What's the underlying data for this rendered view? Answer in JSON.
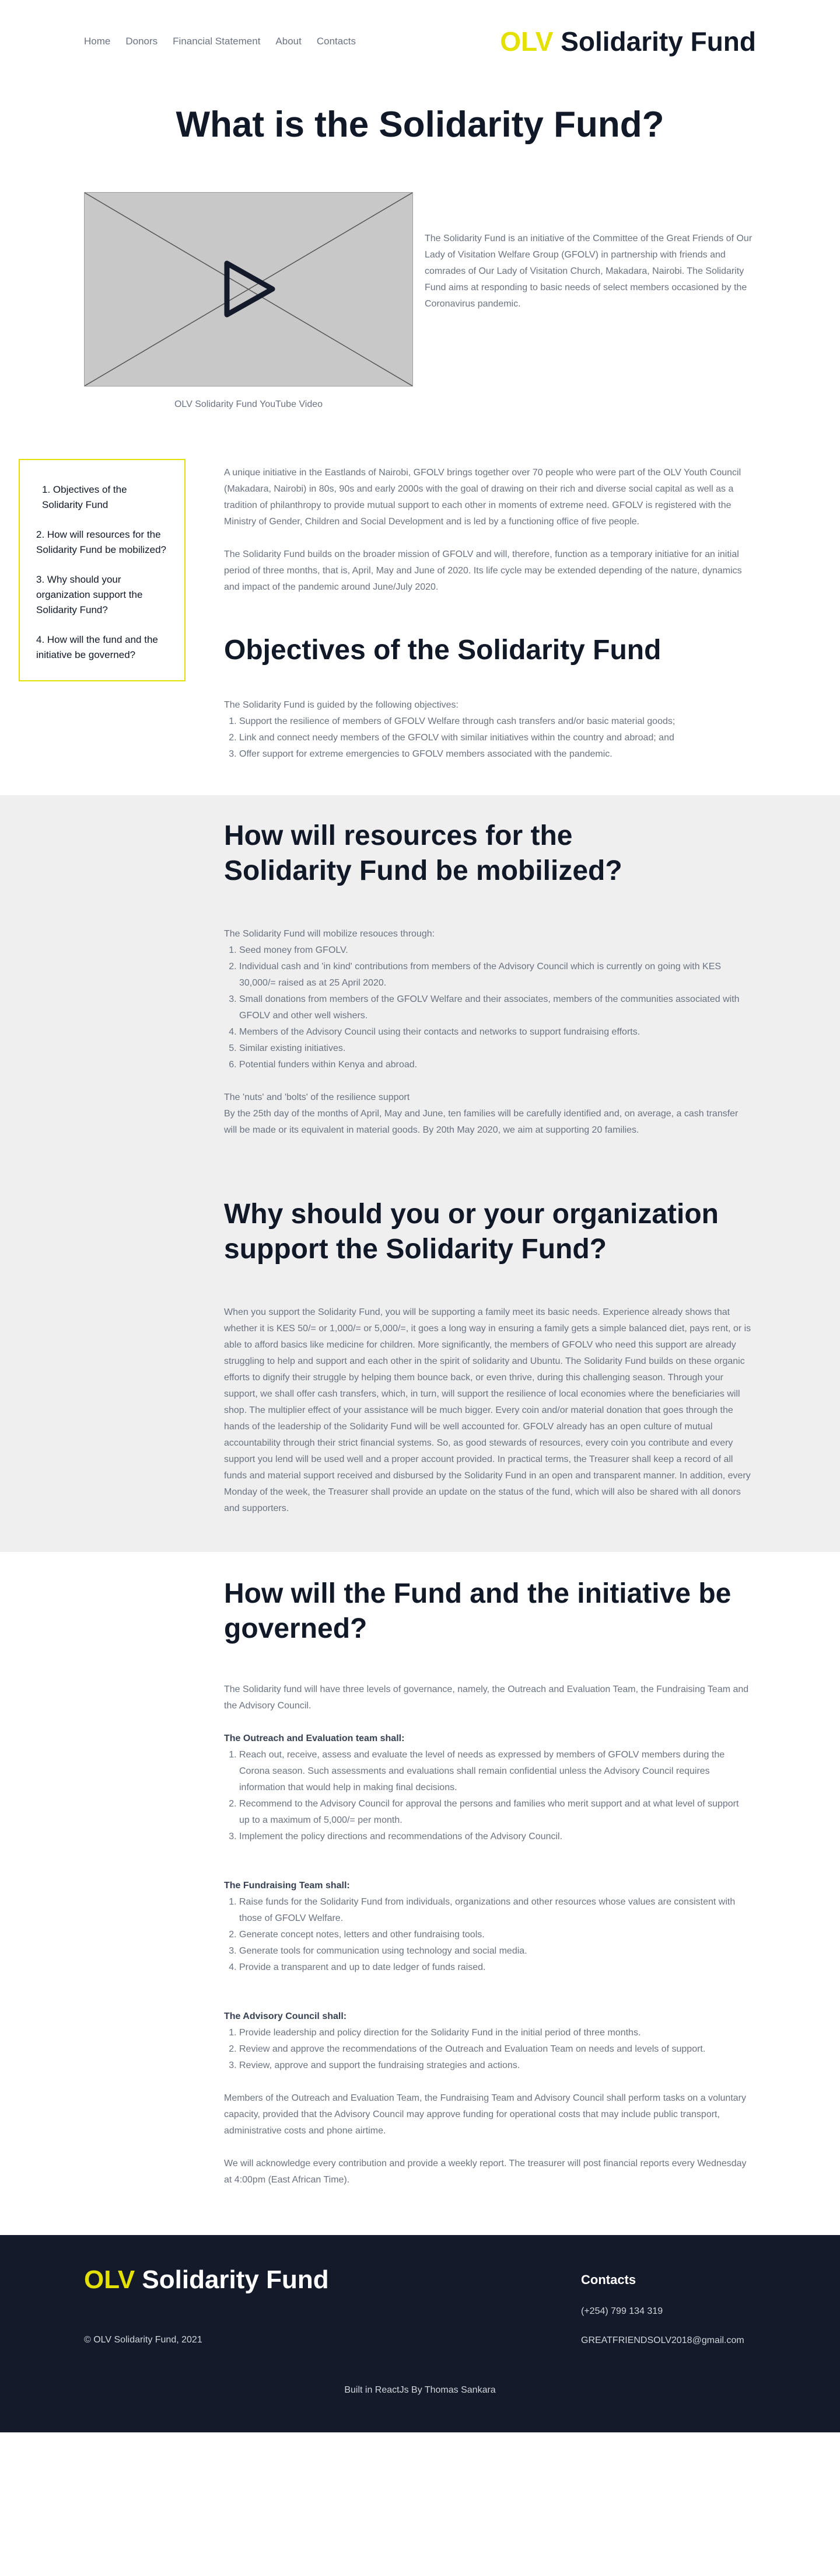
{
  "nav": {
    "links": [
      "Home",
      "Donors",
      "Financial Statement",
      "About",
      "Contacts"
    ],
    "brand_accent": "OLV",
    "brand_rest": " Solidarity Fund"
  },
  "hero": {
    "title": "What is the Solidarity Fund?"
  },
  "video": {
    "caption": "OLV Solidarity Fund YouTube Video",
    "icon": "play-icon"
  },
  "intro": "The Solidarity Fund is an initiative of the Committee of the Great Friends of Our Lady of Visitation Welfare Group (GFOLV) in partnership with friends and comrades of Our Lady of Visitation Church, Makadara, Nairobi. The Solidarity Fund aims at responding to basic needs of select members occasioned by the Coronavirus pandemic.",
  "toc": [
    "1. Objectives of the Solidarity Fund",
    "2. How will resources for the Solidarity Fund be mobilized?",
    "3. Why should your organization support the Solidarity Fund?",
    "4. How will the fund and the initiative be governed?"
  ],
  "about": {
    "p1": "A unique initiative in the Eastlands of Nairobi, GFOLV brings together over 70 people who were part of the OLV Youth Council (Makadara, Nairobi) in 80s, 90s and early 2000s with the goal of drawing on their rich and diverse social capital as well as a tradition of philanthropy to provide mutual support to each other in moments of extreme need. GFOLV is registered with the Ministry of Gender, Children and Social Development and is led by a functioning office of five people.",
    "p2": "The Solidarity Fund builds on the broader mission of GFOLV and will, therefore, function as a temporary initiative for an initial period of three months, that is, April, May and June of 2020. Its life cycle may be extended depending of the nature, dynamics and impact of the pandemic around June/July 2020."
  },
  "objectives": {
    "title": "Objectives of the Solidarity Fund",
    "lead": "The Solidarity Fund is guided by the following objectives:",
    "items": [
      "Support the resilience of members of GFOLV Welfare through cash transfers and/or basic material goods;",
      "Link and connect needy members of the GFOLV with similar initiatives within the country and abroad; and",
      "Offer support for extreme emergencies to GFOLV members associated with the pandemic."
    ]
  },
  "resources": {
    "title": "How will resources for the Solidarity Fund be mobilized?",
    "lead": "The Solidarity Fund will mobilize resouces through:",
    "items": [
      "Seed money from GFOLV.",
      "Individual cash and 'in kind' contributions from members of the Advisory Council which is currently on going with KES 30,000/= raised as at 25 April 2020.",
      "Small donations from members of the GFOLV Welfare and their associates, members of the communities associated with GFOLV and other well wishers.",
      "Members of the Advisory Council using their contacts and networks to support fundraising efforts.",
      "Similar existing initiatives.",
      "Potential funders within Kenya and abroad."
    ],
    "nuts_title": "The 'nuts' and 'bolts' of the resilience support",
    "nuts_text": "By the 25th day of the months of April, May and June, ten families will be carefully identified and, on average, a cash transfer will be made or its equivalent in material goods. By 20th May 2020, we aim at supporting 20 families."
  },
  "support": {
    "title": "Why should you or your organization support the Solidarity Fund?",
    "text": "When you support the Solidarity Fund, you will be supporting a family meet its basic needs. Experience already shows that whether it is KES 50/= or 1,000/= or 5,000/=, it goes a long way in ensuring a family gets a simple balanced diet, pays rent, or is able to afford basics like medicine for children. More significantly, the members of GFOLV who need this support are already struggling to help and support and each other in the spirit of solidarity and Ubuntu. The Solidarity Fund builds on these organic efforts to dignify their struggle by helping them bounce back, or even thrive, during this challenging season. Through your support, we shall offer cash transfers, which, in turn, will support the resilience of local economies where the beneficiaries will shop. The multiplier effect of your assistance will be much bigger. Every coin and/or material donation that goes through the hands of the leadership of the Solidarity Fund will be well accounted for. GFOLV already has an open culture of mutual accountability through their strict financial systems. So, as good stewards of resources, every coin you contribute and every support you lend will be used well and a proper account provided. In practical terms, the Treasurer shall keep a record of all funds and material support received and disbursed by the Solidarity Fund in an open and transparent manner. In addition, every Monday of the week, the Treasurer shall provide an update on the status of the fund, which will also be shared with all donors and supporters."
  },
  "governance": {
    "title": "How will the Fund and the initiative be governed?",
    "lead": "The Solidarity fund will have three levels of governance, namely, the Outreach and Evaluation Team, the Fundraising Team and the Advisory Council.",
    "outreach_title": "The Outreach and Evaluation team shall:",
    "outreach_items": [
      "Reach out, receive, assess and evaluate the level of needs as expressed by members of GFOLV members during the Corona season. Such assessments and evaluations shall remain confidential unless the Advisory Council requires information that would help in making final decisions.",
      "Recommend to the Advisory Council for approval the persons and families who merit support and at what level of support up to a maximum of 5,000/= per month.",
      "Implement the policy directions and recommendations of the Advisory Council."
    ],
    "fund_title": "The Fundraising Team shall:",
    "fund_items": [
      "Raise funds for the Solidarity Fund from individuals, organizations and other resources whose values are consistent with those of GFOLV Welfare.",
      "Generate concept notes, letters and other fundraising tools.",
      "Generate tools for communication using technology and social media.",
      "Provide a transparent and up to date ledger of funds raised."
    ],
    "council_title": "The Advisory Council shall:",
    "council_items": [
      "Provide leadership and policy direction for the Solidarity Fund in the initial period of three months.",
      "Review and approve the recommendations of the Outreach and Evaluation Team on needs and levels of support.",
      "Review, approve and support the fundraising strategies and actions."
    ],
    "closing1": "Members of the Outreach and Evaluation Team, the Fundraising Team and Advisory Council shall perform tasks on a voluntary capacity, provided that the Advisory Council may approve funding for operational costs that may include public transport, administrative costs and phone airtime.",
    "closing2": "We will acknowledge every contribution and provide a weekly report. The treasurer will post financial reports every Wednesday at 4:00pm (East African Time)."
  },
  "footer": {
    "brand_accent": "OLV",
    "brand_rest": " Solidarity Fund",
    "copyright": "© OLV Solidarity Fund, 2021",
    "contacts_title": "Contacts",
    "phone": "(+254) 799 134 319",
    "email": "GREATFRIENDSOLV2018@gmail.com",
    "built_by": "Built in ReactJs By Thomas Sankara"
  },
  "colors": {
    "accent": "#e4e000",
    "heading": "#111827",
    "footer_bg": "#151a2b",
    "band_bg": "#efefef"
  }
}
